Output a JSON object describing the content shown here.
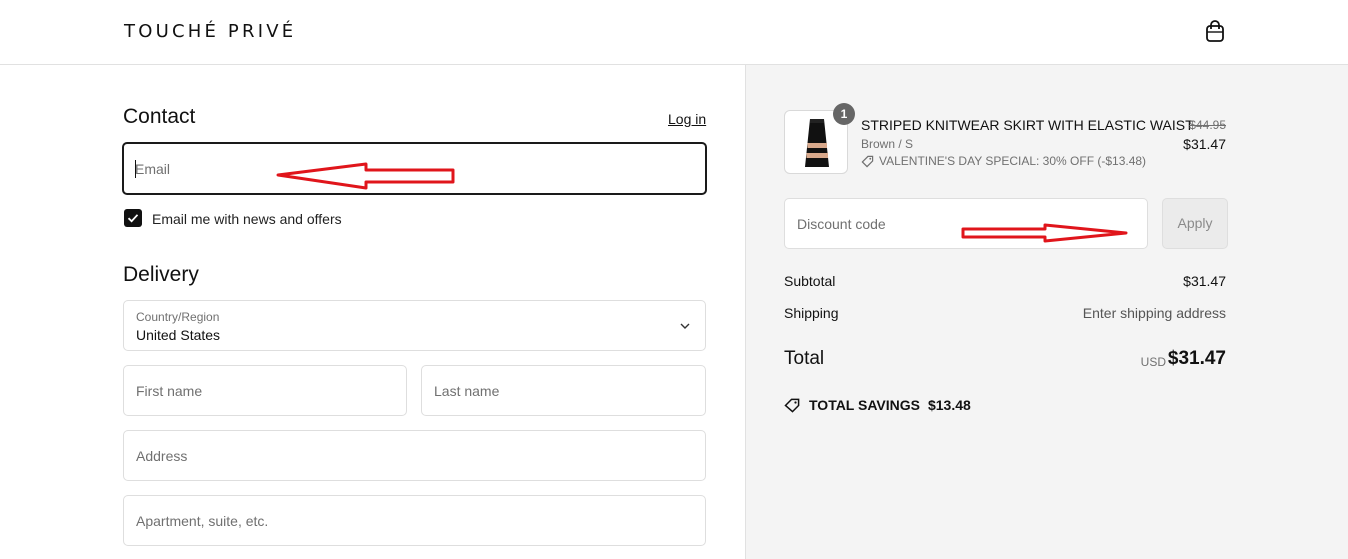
{
  "header": {
    "brand": "TOUCHÉ PRIVÉ",
    "cart_icon": "shopping-bag-icon"
  },
  "contact": {
    "title": "Contact",
    "login_label": "Log in",
    "email_placeholder": "Email",
    "newsletter_label": "Email me with news and offers",
    "newsletter_checked": true
  },
  "delivery": {
    "title": "Delivery",
    "country_label": "Country/Region",
    "country_value": "United States",
    "first_name_placeholder": "First name",
    "last_name_placeholder": "Last name",
    "address_placeholder": "Address",
    "apartment_placeholder": "Apartment, suite, etc."
  },
  "order": {
    "item": {
      "quantity": "1",
      "name": "STRIPED KNITWEAR SKIRT WITH ELASTIC WAIST",
      "variant": "Brown / S",
      "discount": "VALENTINE'S DAY SPECIAL: 30% OFF (-$13.48)",
      "original_price": "$44.95",
      "price": "$31.47"
    },
    "discount_placeholder": "Discount code",
    "apply_label": "Apply",
    "subtotal_label": "Subtotal",
    "subtotal_value": "$31.47",
    "shipping_label": "Shipping",
    "shipping_value": "Enter shipping address",
    "total_label": "Total",
    "currency": "USD",
    "total_value": "$31.47",
    "savings_label": "TOTAL SAVINGS",
    "savings_value": "$13.48"
  },
  "colors": {
    "annotation_arrow": "#e0151b",
    "summary_bg": "#f4f4f4",
    "text": "#111111"
  }
}
